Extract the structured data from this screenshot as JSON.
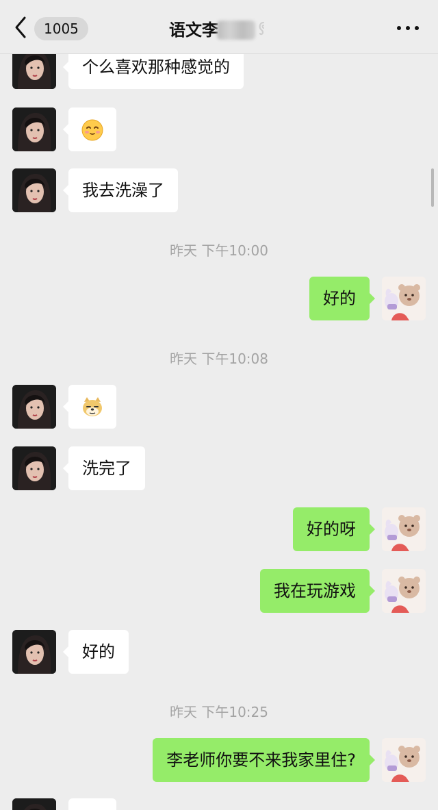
{
  "header": {
    "unread_count": "1005",
    "title": "语文李"
  },
  "messages": [
    {
      "text": "个么喜欢那种感觉的"
    },
    {
      "text": "我去洗澡了"
    },
    {
      "time": "昨天 下午10:00"
    },
    {
      "text": "好的"
    },
    {
      "time": "昨天 下午10:08"
    },
    {
      "text": "洗完了"
    },
    {
      "text": "好的呀"
    },
    {
      "text": "我在玩游戏"
    },
    {
      "text": "好的"
    },
    {
      "time": "昨天 下午10:25"
    },
    {
      "text": "李老师你要不来我家里住?"
    }
  ],
  "colors": {
    "background": "#ededed",
    "bubble_self": "#95ec69",
    "bubble_other": "#ffffff",
    "timestamp": "#a3a3a3"
  },
  "icons": [
    "back-chevron-icon",
    "voice-icon",
    "more-icon",
    "emoji-smile-icon",
    "emoji-doge-icon"
  ]
}
